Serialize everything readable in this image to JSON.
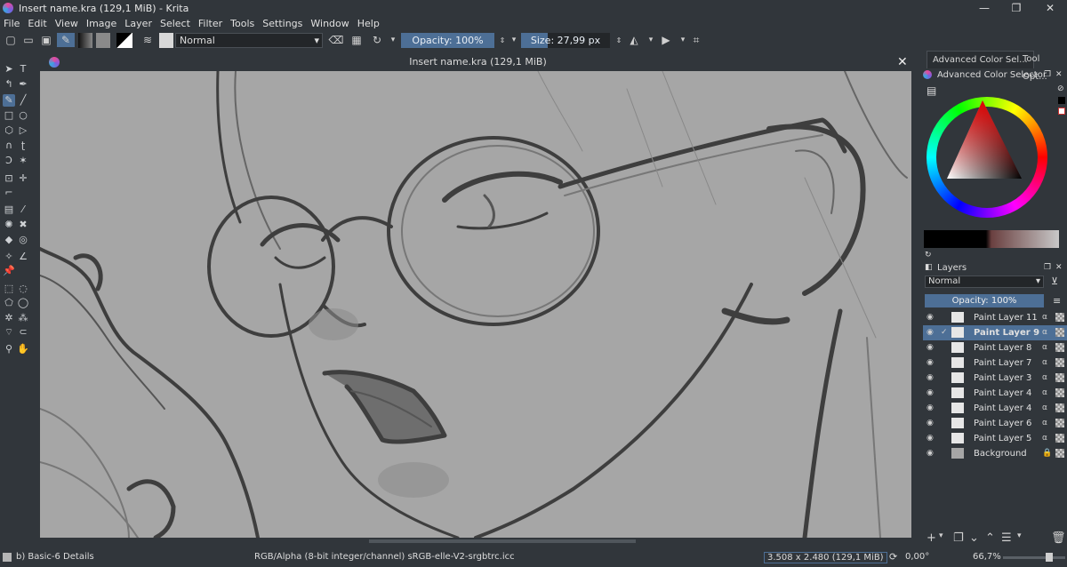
{
  "window": {
    "title": "Insert name.kra (129,1 MiB)  - Krita",
    "minimize": "—",
    "maximize": "❐",
    "close": "✕"
  },
  "menu": [
    "File",
    "Edit",
    "View",
    "Image",
    "Layer",
    "Select",
    "Filter",
    "Tools",
    "Settings",
    "Window",
    "Help"
  ],
  "toolbar": {
    "blend_mode": "Normal",
    "opacity": "Opacity: 100%",
    "size": "Size: 27,99 px"
  },
  "document": {
    "tab_title": "Insert name.kra (129,1 MiB)"
  },
  "dockers": {
    "tabs": [
      "Advanced Color Sel...",
      "Tool Opt..."
    ],
    "color_selector_title": "Advanced Color Selector",
    "layers_title": "Layers",
    "layers_blend": "Normal",
    "layers_opacity": "Opacity:  100%"
  },
  "layers": [
    {
      "name": "Paint Layer 11",
      "selected": false
    },
    {
      "name": "Paint Layer 9",
      "selected": true
    },
    {
      "name": "Paint Layer 8",
      "selected": false
    },
    {
      "name": "Paint Layer 7",
      "selected": false
    },
    {
      "name": "Paint Layer 3",
      "selected": false
    },
    {
      "name": "Paint Layer 4",
      "selected": false
    },
    {
      "name": "Paint Layer 4",
      "selected": false
    },
    {
      "name": "Paint Layer 6",
      "selected": false
    },
    {
      "name": "Paint Layer 5",
      "selected": false
    },
    {
      "name": "Background",
      "selected": false
    }
  ],
  "status": {
    "brush": "b) Basic-6 Details",
    "color_space": "RGB/Alpha (8-bit integer/channel)  sRGB-elle-V2-srgbtrc.icc",
    "image_size": "3.508 x 2.480 (129,1 MiB)",
    "rotation": "0,00°",
    "zoom": "66,7%"
  },
  "colors": {
    "accent": "#4d6f96",
    "panel": "#31363b",
    "canvas": "#a6a6a6"
  }
}
